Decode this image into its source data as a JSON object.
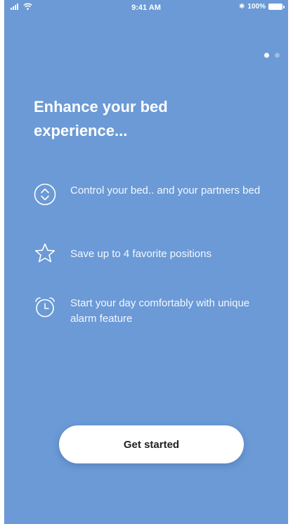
{
  "status_bar": {
    "time": "9:41 AM",
    "battery": "100%",
    "bluetooth_glyph": "✱"
  },
  "pager": {
    "count": 2,
    "active_index": 0
  },
  "onboarding": {
    "headline": "Enhance your bed experience...",
    "features": [
      {
        "icon": "up-down-arrows-icon",
        "text": "Control your bed.. and your partners bed"
      },
      {
        "icon": "star-icon",
        "text": "Save up to 4 favorite positions"
      },
      {
        "icon": "alarm-clock-icon",
        "text": "Start your day comfortably with unique alarm feature"
      }
    ],
    "cta_label": "Get started"
  },
  "colors": {
    "background": "#6b9ad6",
    "text": "#ffffff",
    "button_bg": "#ffffff",
    "button_text": "#222222"
  }
}
